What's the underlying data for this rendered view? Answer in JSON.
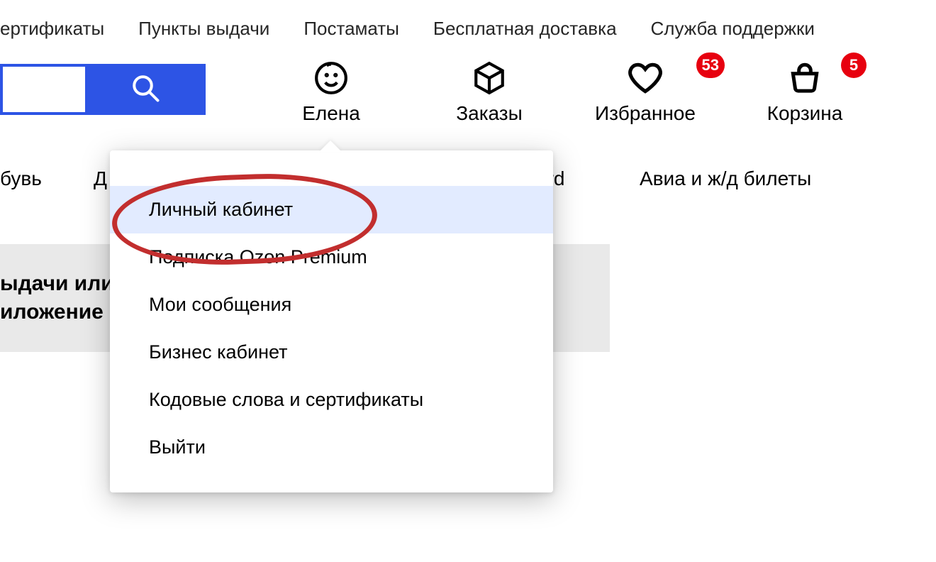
{
  "topnav": {
    "items": [
      "ертификаты",
      "Пункты выдачи",
      "Постаматы",
      "Бесплатная доставка",
      "Служба поддержки"
    ]
  },
  "search": {
    "value": ""
  },
  "header_items": {
    "profile": {
      "label": "Елена"
    },
    "orders": {
      "label": "Заказы"
    },
    "favorites": {
      "label": "Избранное",
      "badge": "53"
    },
    "cart": {
      "label": "Корзина",
      "badge": "5"
    }
  },
  "categories": {
    "c1": "бувь",
    "c2": "Д",
    "c3_suffix": "ard",
    "c4": "Авиа и ж/д билеты"
  },
  "banner": {
    "line1": "ыдачи или",
    "line2": "иложение"
  },
  "dropdown": {
    "items": [
      "Личный кабинет",
      "Подписка Ozon Premium",
      "Мои сообщения",
      "Бизнес кабинет",
      "Кодовые слова и сертификаты",
      "Выйти"
    ],
    "highlighted_index": 0
  }
}
